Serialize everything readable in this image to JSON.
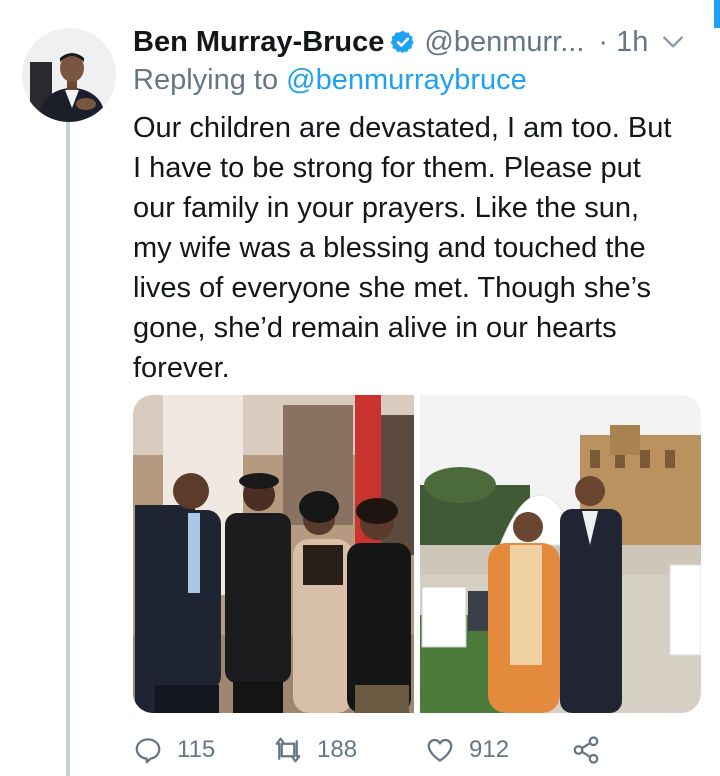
{
  "tweet": {
    "author_name": "Ben Murray-Bruce",
    "author_handle": "@benmurr...",
    "time_separator": "·",
    "time": "1h",
    "reply_prefix": "Replying to",
    "reply_to_handle": "@benmurraybruce",
    "text_lines": [
      "Our children are devastated, I am too. But",
      "I have to be strong for them. Please put",
      "our family in your prayers. Like the sun,",
      "my wife was a blessing and touched the",
      "lives of everyone she met. Though she’s",
      "gone, she’d remain alive in our hearts",
      "forever."
    ]
  },
  "media": [
    {
      "icon": "photo",
      "subject": "family-group-photo"
    },
    {
      "icon": "photo",
      "subject": "couple-outdoor-photo"
    }
  ],
  "actions": {
    "reply_count": "115",
    "retweet_count": "188",
    "like_count": "912",
    "icons": [
      "reply-icon",
      "retweet-icon",
      "like-icon",
      "share-icon"
    ]
  },
  "colors": {
    "accent": "#1da1f2",
    "text_primary": "#14171a",
    "text_secondary": "#657786",
    "thread_line": "#c4cfd6"
  }
}
